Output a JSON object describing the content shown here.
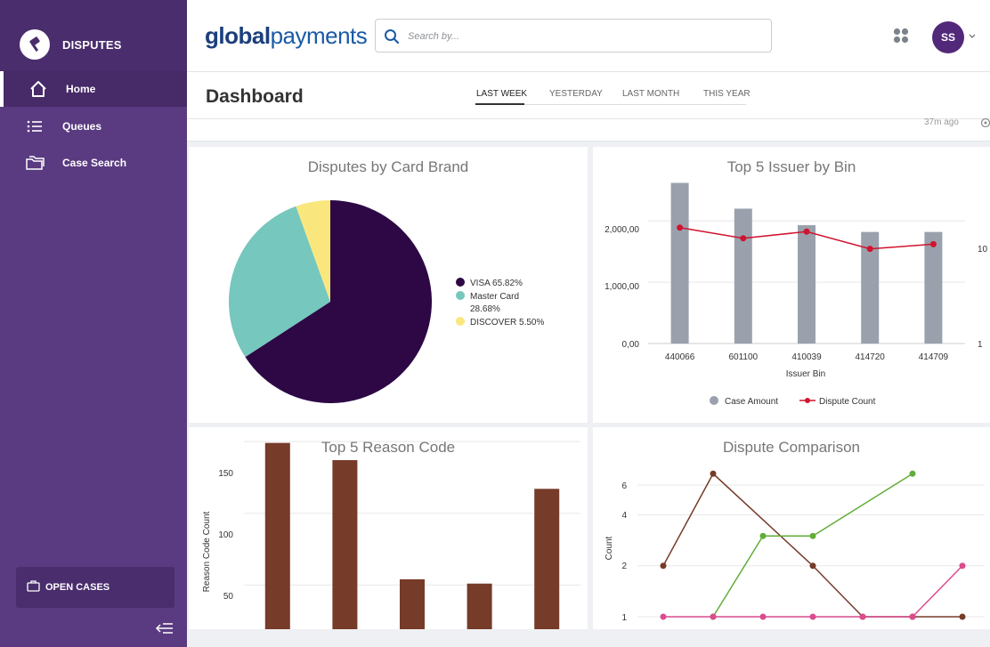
{
  "sidebar": {
    "title": "DISPUTES",
    "items": [
      {
        "label": "Home",
        "icon": "home-icon",
        "active": true
      },
      {
        "label": "Queues",
        "icon": "list-icon",
        "active": false
      },
      {
        "label": "Case Search",
        "icon": "folders-icon",
        "active": false
      }
    ],
    "open_cases_label": "OPEN CASES"
  },
  "header": {
    "brand_bold": "global",
    "brand_light": "payments",
    "search_placeholder": "Search by...",
    "avatar_initials": "SS"
  },
  "dashboard": {
    "title": "Dashboard",
    "tabs": [
      "LAST WEEK",
      "YESTERDAY",
      "LAST MONTH",
      "THIS YEAR"
    ],
    "active_tab": "LAST WEEK",
    "updated": "37m ago"
  },
  "colors": {
    "sidebar": "#5a3a80",
    "visa": "#2d0845",
    "mastercard": "#76c7bd",
    "discover": "#f9e77e",
    "bar_gray": "#9aa1ad",
    "line_red": "#d0142f",
    "bar_brown": "#763b29",
    "green": "#62ad3a",
    "pink": "#d94c8e"
  },
  "chart_data": [
    {
      "type": "pie",
      "title": "Disputes by Card Brand",
      "slices": [
        {
          "label": "VISA",
          "pct_label": "65.82%",
          "value": 65.82
        },
        {
          "label": "Master Card",
          "pct_label": "28.68%",
          "value": 28.68
        },
        {
          "label": "DISCOVER",
          "pct_label": "5.50%",
          "value": 5.5
        }
      ],
      "legend": "right"
    },
    {
      "type": "bar",
      "title": "Top 5 Issuer by Bin",
      "categories": [
        "440066",
        "601100",
        "410039",
        "414720",
        "414709"
      ],
      "xlabel": "Issuer Bin",
      "yticks": [
        "0,00",
        "1,000,00",
        "2,000,00"
      ],
      "ylim": [
        0,
        2700
      ],
      "series": [
        {
          "name": "Case Amount",
          "values": [
            2620,
            2200,
            1930,
            1820,
            1820
          ]
        }
      ],
      "line_series": {
        "name": "Dispute Count",
        "values": [
          14.5,
          12.9,
          13.9,
          11.3,
          12.0
        ],
        "ylim": [
          -3,
          22
        ]
      },
      "right_ticks": [
        "10",
        "1"
      ],
      "legend": "bottom"
    },
    {
      "type": "bar",
      "title": "Top 5 Reason Code",
      "ylabel": "Reason Code Count",
      "yticks": [
        "50",
        "100",
        "150"
      ],
      "ylim": [
        0,
        155
      ],
      "values": [
        149,
        137,
        54,
        51,
        117
      ]
    },
    {
      "type": "line",
      "title": "Dispute Comparison",
      "ylabel": "Count",
      "yticks": [
        "1",
        "2",
        "4",
        "6"
      ],
      "yscale": "log",
      "series": [
        {
          "values": [
            2,
            7,
            null,
            2,
            1,
            1,
            1
          ]
        },
        {
          "values": [
            null,
            1,
            3,
            3,
            null,
            7,
            null
          ]
        },
        {
          "values": [
            1,
            1,
            1,
            1,
            1,
            1,
            2
          ]
        }
      ]
    }
  ]
}
